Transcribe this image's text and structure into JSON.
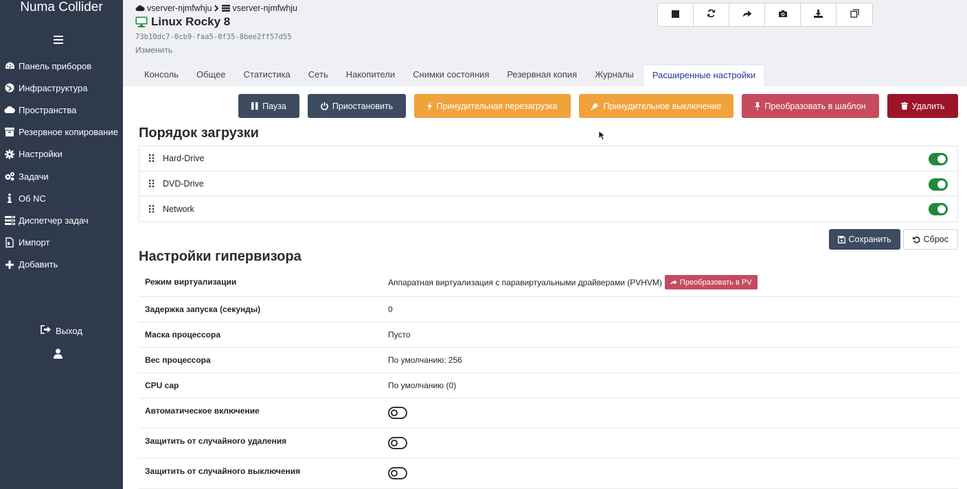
{
  "app": {
    "brand": "Numa Collider"
  },
  "sidebar": {
    "items": [
      {
        "label": "Панель приборов",
        "icon": "dashboard-icon"
      },
      {
        "label": "Инфраструктура",
        "icon": "globe-icon"
      },
      {
        "label": "Пространства",
        "icon": "cloud-icon"
      },
      {
        "label": "Резервное копирование",
        "icon": "archive-icon"
      },
      {
        "label": "Настройки",
        "icon": "gear-icon"
      },
      {
        "label": "Задачи",
        "icon": "gears-icon"
      },
      {
        "label": "Об NC",
        "icon": "info-icon"
      },
      {
        "label": "Диспетчер задач",
        "icon": "tasks-icon"
      },
      {
        "label": "Импорт",
        "icon": "import-icon"
      },
      {
        "label": "Добавить",
        "icon": "plus-icon"
      }
    ],
    "logout_label": "Выход"
  },
  "header": {
    "breadcrumb": {
      "pool": "vserver-njmfwhju",
      "host": "vserver-njmfwhju"
    },
    "vm_name": "Linux Rocky 8",
    "uuid": "73b10dc7-0cb9-faa5-0f35-8bee2ff57d55",
    "edit_label": "Изменить",
    "toolbar": [
      "stop-icon",
      "restart-icon",
      "migrate-icon",
      "snapshot-icon",
      "export-icon",
      "copy-icon"
    ]
  },
  "tabs": [
    {
      "label": "Консоль",
      "active": false
    },
    {
      "label": "Общее",
      "active": false
    },
    {
      "label": "Статистика",
      "active": false
    },
    {
      "label": "Сеть",
      "active": false
    },
    {
      "label": "Накопители",
      "active": false
    },
    {
      "label": "Снимки состояния",
      "active": false
    },
    {
      "label": "Резервная копия",
      "active": false
    },
    {
      "label": "Журналы",
      "active": false
    },
    {
      "label": "Расширенные настройки",
      "active": true
    }
  ],
  "actions": {
    "pause": "Пауза",
    "suspend": "Приостановить",
    "force_reboot": "Принудительная перезагрузка",
    "force_shutdown": "Принудительное выключение",
    "to_template": "Преобразовать в шаблон",
    "delete": "Удалить"
  },
  "boot": {
    "title": "Порядок загрузки",
    "items": [
      {
        "label": "Hard-Drive",
        "enabled": true
      },
      {
        "label": "DVD-Drive",
        "enabled": true
      },
      {
        "label": "Network",
        "enabled": true
      }
    ],
    "save_label": "Сохранить",
    "reset_label": "Сброс"
  },
  "hypervisor": {
    "title": "Настройки гипервизора",
    "virt_mode": {
      "label": "Режим виртуализации",
      "value": "Аппаратная виртуализация с паравиртуальными драйверами (PVHVM)",
      "button": "Преобразовать в PV"
    },
    "start_delay": {
      "label": "Задержка запуска (секунды)",
      "value": "0"
    },
    "cpu_mask": {
      "label": "Маска процессора",
      "value": "Пусто"
    },
    "cpu_weight": {
      "label": "Вес процессора",
      "value": "По умолчанию: 256"
    },
    "cpu_cap": {
      "label": "CPU cap",
      "value": "По умолчанию (0)"
    },
    "auto_power": {
      "label": "Автоматическое включение",
      "enabled": false
    },
    "protect_delete": {
      "label": "Защитить от случайного удаления",
      "enabled": false
    },
    "protect_shutdown": {
      "label": "Защитить от случайного выключения",
      "enabled": false
    }
  },
  "colors": {
    "sidebar": "#2f3a4d",
    "dark_button": "#3c4b5f",
    "orange": "#f0a23b",
    "rose": "#c64b5e",
    "danger": "#9c1428",
    "toggle_on": "#1f8a3c",
    "tab_active": "#283593"
  }
}
